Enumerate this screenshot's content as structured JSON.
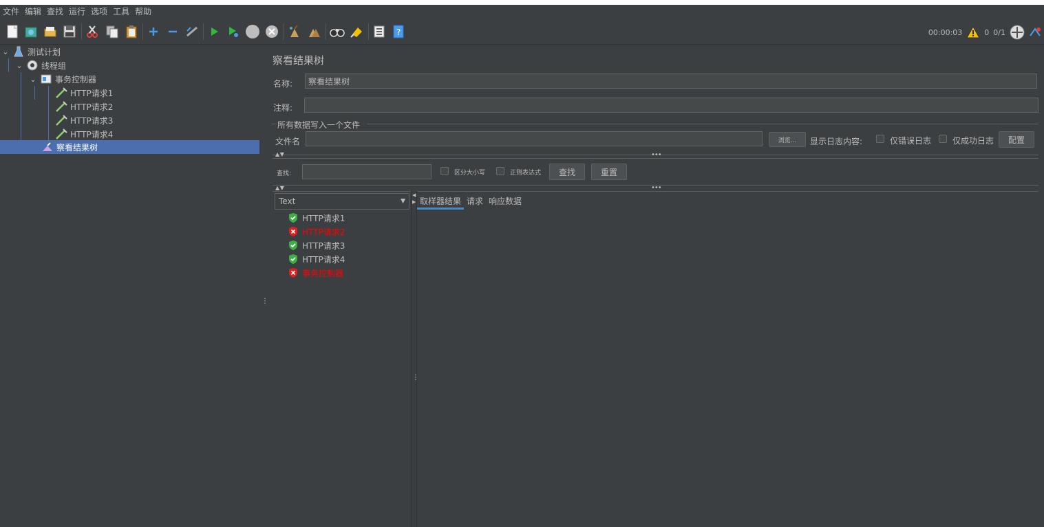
{
  "menu": [
    "文件",
    "编辑",
    "查找",
    "运行",
    "选项",
    "工具",
    "帮助"
  ],
  "toolbar": {
    "icons": [
      "new-icon",
      "templates-icon",
      "open-icon",
      "save-icon",
      "cut-icon",
      "copy-icon",
      "paste-icon",
      "expand-icon",
      "collapse-icon",
      "toggle-icon",
      "start-icon",
      "start-no-pause-icon",
      "stop-icon",
      "shutdown-icon",
      "clear-icon",
      "clear-all-icon",
      "search-icon",
      "reset-search-icon",
      "function-helper-icon",
      "help-icon"
    ],
    "timer": "00:00:03",
    "warning_count": "0",
    "thread_count": "0/1"
  },
  "tree": [
    {
      "label": "测试计划",
      "icon": "test-plan-icon",
      "level": 0
    },
    {
      "label": "线程组",
      "icon": "gear-icon",
      "level": 1
    },
    {
      "label": "事务控制器",
      "icon": "controller-icon",
      "level": 2
    },
    {
      "label": "HTTP请求1",
      "icon": "sampler-icon",
      "level": 3
    },
    {
      "label": "HTTP请求2",
      "icon": "sampler-icon",
      "level": 3
    },
    {
      "label": "HTTP请求3",
      "icon": "sampler-icon",
      "level": 3
    },
    {
      "label": "HTTP请求4",
      "icon": "sampler-icon",
      "level": 3
    },
    {
      "label": "察看结果树",
      "icon": "listener-icon",
      "level": 2,
      "selected": true
    }
  ],
  "panel": {
    "title": "察看结果树",
    "name_label": "名称:",
    "name_value": "察看结果树",
    "comment_label": "注释:",
    "comment_value": "",
    "file_section": "所有数据写入一个文件",
    "filename_label": "文件名",
    "filename_value": "",
    "browse_button": "浏览...",
    "log_label": "显示日志内容:",
    "errors_only": "仅错误日志",
    "success_only": "仅成功日志",
    "configure_button": "配置",
    "search_label": "查找:",
    "search_value": "",
    "case_sensitive": "区分大小写",
    "regex": "正则表达式",
    "find_button": "查找",
    "reset_button": "重置"
  },
  "results": {
    "renderer": "Text",
    "items": [
      {
        "label": "HTTP请求1",
        "status": "success"
      },
      {
        "label": "HTTP请求2",
        "status": "error"
      },
      {
        "label": "HTTP请求3",
        "status": "success"
      },
      {
        "label": "HTTP请求4",
        "status": "success"
      },
      {
        "label": "事务控制器",
        "status": "error"
      }
    ],
    "tabs": [
      "取样器结果",
      "请求",
      "响应数据"
    ]
  },
  "colors": {
    "background": "#3c3f41",
    "selection": "#4b6eaf",
    "error_text": "#ff0000",
    "success_icon": "#3cb043",
    "error_icon": "#e02020"
  }
}
